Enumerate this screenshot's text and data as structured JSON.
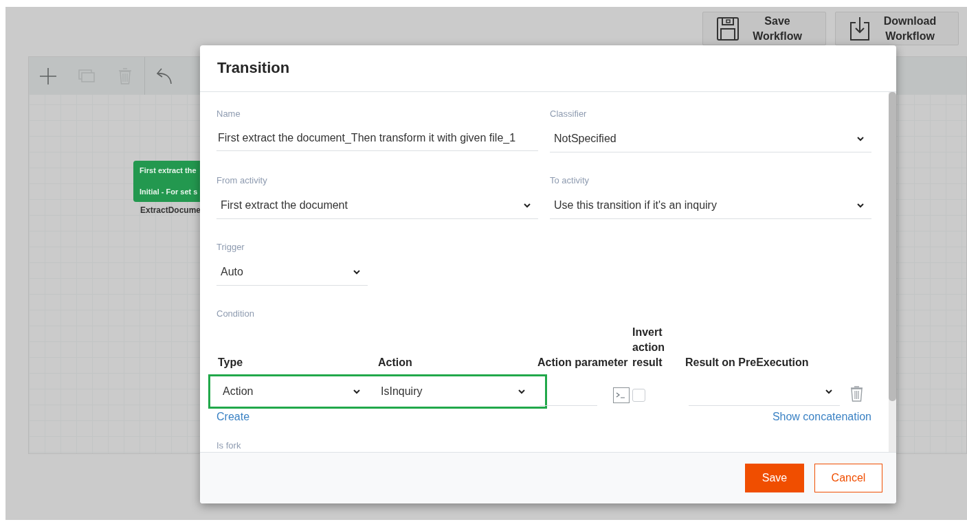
{
  "header_buttons": [
    {
      "kind": "save",
      "label": "Save Workflow"
    },
    {
      "kind": "download",
      "label": "Download Workflow"
    }
  ],
  "canvas": {
    "tools": [
      {
        "kind": "add",
        "disabled": false
      },
      {
        "kind": "copy",
        "disabled": true
      },
      {
        "kind": "delete",
        "disabled": true
      },
      {
        "kind": "undo",
        "disabled": false
      }
    ],
    "node": {
      "title": "First extract the",
      "subtitle": "Initial - For set s",
      "caption": "ExtractDocume"
    }
  },
  "dialog": {
    "title": "Transition",
    "rows": [
      [
        {
          "label": "Name",
          "kind": "text",
          "value": "First extract the document_Then transform it with given file_1"
        },
        {
          "label": "Classifier",
          "kind": "select",
          "value": "NotSpecified"
        }
      ],
      [
        {
          "label": "From activity",
          "kind": "select",
          "value": "First extract the document"
        },
        {
          "label": "To activity",
          "kind": "select",
          "value": "Use this transition if it's an inquiry"
        }
      ],
      [
        {
          "label": "Trigger",
          "kind": "select",
          "value": "Auto"
        }
      ]
    ],
    "condition": {
      "label": "Condition",
      "columns": [
        "Type",
        "Action",
        "Action parameter",
        "Invert action result",
        "Result on PreExecution"
      ],
      "rows": [
        {
          "type": "Action",
          "action": "IsInquiry",
          "invert": false,
          "highlighted": true
        }
      ],
      "create_link": "Create",
      "concat_link": "Show concatenation"
    },
    "next_label": "Is fork",
    "buttons": [
      {
        "kind": "primary",
        "label": "Save"
      },
      {
        "kind": "secondary",
        "label": "Cancel"
      }
    ]
  }
}
